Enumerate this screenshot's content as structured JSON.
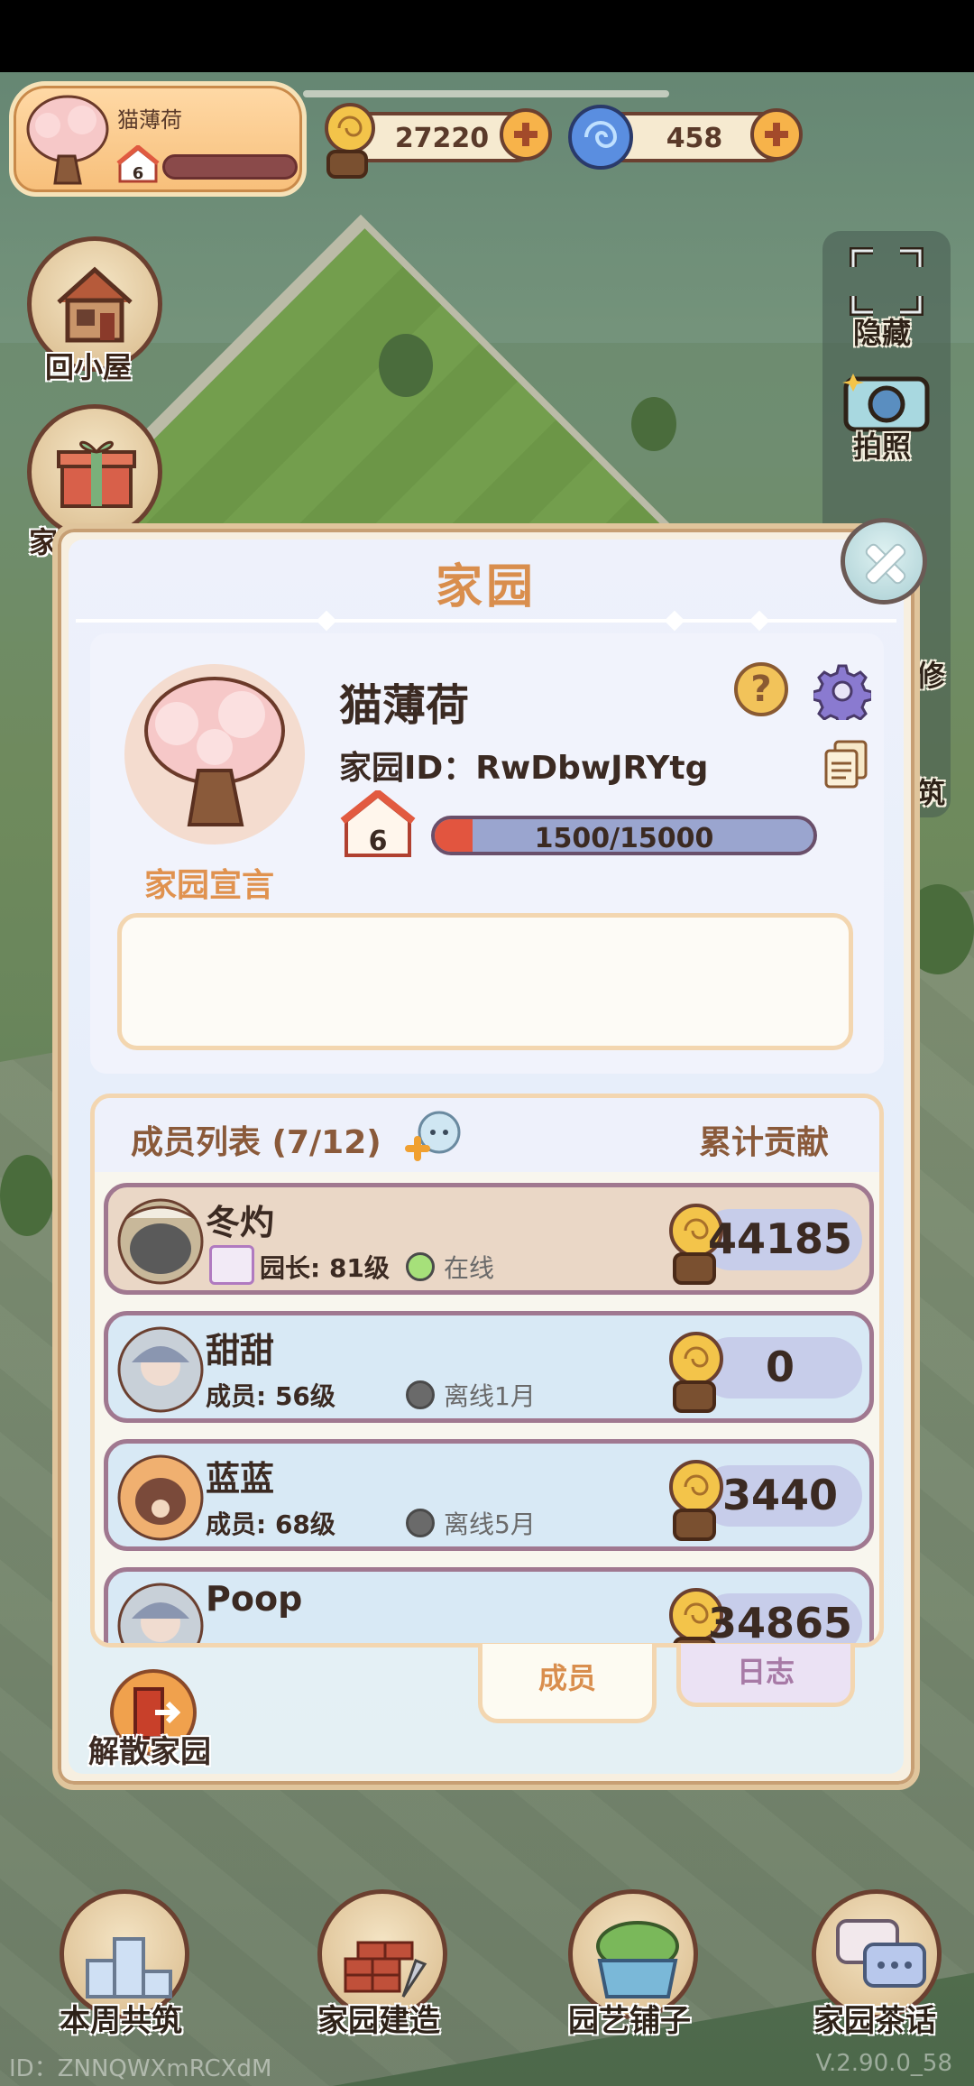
{
  "top": {
    "player_name": "猫薄荷",
    "player_level": "6",
    "coins": "27220",
    "gems": "458"
  },
  "left_buttons": {
    "home": "回小屋",
    "garden_partial": "家"
  },
  "right_tools": {
    "hide": "隐藏",
    "photo": "拍照",
    "repair_partial": "修",
    "build_partial": "筑"
  },
  "modal": {
    "title": "家园",
    "garden_name": "猫薄荷",
    "garden_id": "家园ID：RwDbwJRYtg",
    "garden_level": "6",
    "exp_text": "1500/15000",
    "exp_fraction": 0.1,
    "manifesto_label": "家园宣言",
    "manifesto_text": "",
    "members_title": "成员列表 (7/12)",
    "contribution_title": "累计贡献",
    "members": [
      {
        "name": "冬灼",
        "role": "园长: 81级",
        "status": "在线",
        "score": "44185",
        "online": true,
        "leader": true
      },
      {
        "name": "甜甜",
        "role": "成员: 56级",
        "status": "离线1月",
        "score": "0",
        "online": false,
        "leader": false
      },
      {
        "name": "蓝蓝",
        "role": "成员: 68级",
        "status": "离线5月",
        "score": "3440",
        "online": false,
        "leader": false
      },
      {
        "name": "Poop",
        "role": "",
        "status": "",
        "score": "34865",
        "online": false,
        "leader": false
      }
    ],
    "tabs": {
      "members": "成员",
      "log": "日志"
    },
    "disband": "解散家园"
  },
  "bottom_nav": {
    "weekly": "本周共筑",
    "build": "家园建造",
    "shop": "园艺铺子",
    "chat": "家园茶话"
  },
  "footer": {
    "id": "ID：ZNNQWXmRCXdM",
    "version": "V.2.90.0_58"
  },
  "colors": {
    "accent": "#d98e4d",
    "online": "#a6e07a",
    "offline": "#6a6a6a"
  }
}
